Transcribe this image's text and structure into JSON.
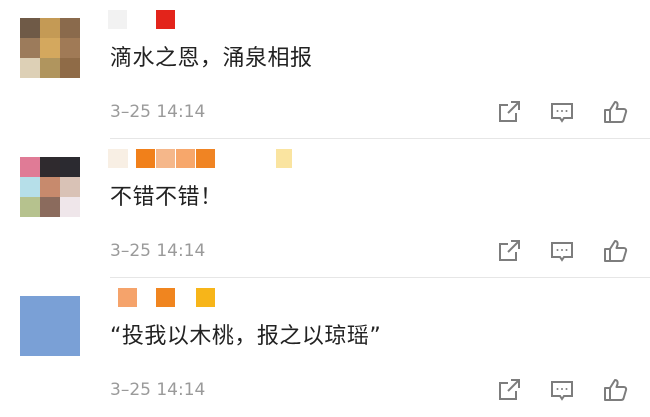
{
  "comments": [
    {
      "text": "滴水之恩，涌泉相报",
      "time": "3–25  14:14",
      "avatar_colors": [
        "#6f5a47",
        "#c49a55",
        "#8a6a4c",
        "#9c7b5b",
        "#d4a85e",
        "#a07a56",
        "#ddd0b6",
        "#b0955e",
        "#8f6b47"
      ],
      "name_blur_colors": [
        "#f2f2f2",
        "#e3241b"
      ]
    },
    {
      "text": "不错不错！",
      "time": "3–25  14:14",
      "avatar_colors": [
        "#e07b96",
        "#2f2a2e",
        "#2b2a30",
        "#b6dfe9",
        "#c78a6d",
        "#d9c2b6",
        "#b6c28e",
        "#8b6b5d",
        "#efe6ea"
      ],
      "name_blur_colors": [
        "#f8efe4",
        "#f1801a",
        "#f5b78a",
        "#f7a76b",
        "#f08423",
        "#fae4a0"
      ]
    },
    {
      "text": "“投我以木桃，报之以琼瑶”",
      "time": "3–25  14:14",
      "avatar_colors": [
        "#7aa0d6"
      ],
      "name_blur_colors": [
        "#f5a36b",
        "#f0851f",
        "#f7b519"
      ]
    }
  ],
  "icons": [
    "share-icon",
    "comment-icon",
    "like-icon"
  ],
  "colors": {
    "text": "#222222",
    "time": "#9a9a9a",
    "icon": "#7d7d7d",
    "divider": "#e6e6e6"
  }
}
